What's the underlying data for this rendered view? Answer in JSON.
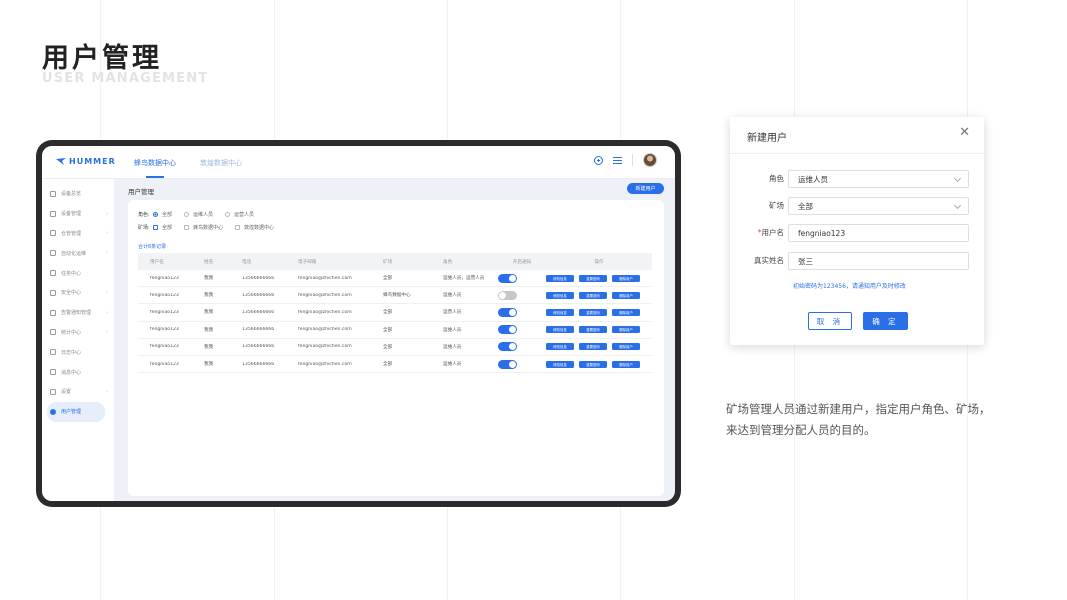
{
  "page": {
    "title": "用户管理",
    "subtitle": "USER MANAGEMENT",
    "description_line1": "矿场管理人员通过新建用户，指定用户角色、矿场，",
    "description_line2": "来达到管理分配人员的目的。"
  },
  "app": {
    "logo": "HUMMER",
    "tabs": [
      {
        "label": "蜂鸟数据中心",
        "active": true
      },
      {
        "label": "敦煌数据中心",
        "active": false
      }
    ],
    "icons": [
      "plus-circle-icon",
      "list-icon",
      "avatar"
    ]
  },
  "sidebar": {
    "items": [
      {
        "label": "设备总览",
        "icon": "dashboard-icon",
        "has_children": false
      },
      {
        "label": "设备管理",
        "icon": "device-icon",
        "has_children": true
      },
      {
        "label": "仓管管理",
        "icon": "warehouse-icon",
        "has_children": true
      },
      {
        "label": "自动化运维",
        "icon": "automation-icon",
        "has_children": true
      },
      {
        "label": "任务中心",
        "icon": "task-icon",
        "has_children": false
      },
      {
        "label": "安全中心",
        "icon": "shield-icon",
        "has_children": true
      },
      {
        "label": "告警通知管理",
        "icon": "alert-icon",
        "has_children": true
      },
      {
        "label": "统计中心",
        "icon": "chart-icon",
        "has_children": true
      },
      {
        "label": "日志中心",
        "icon": "log-icon",
        "has_children": false
      },
      {
        "label": "消息中心",
        "icon": "message-icon",
        "has_children": false
      },
      {
        "label": "设置",
        "icon": "gear-icon",
        "has_children": true
      },
      {
        "label": "用户管理",
        "icon": "user-icon",
        "has_children": false,
        "active": true
      }
    ]
  },
  "content": {
    "title": "用户管理",
    "new_button": "新建用户",
    "filters": {
      "role_label": "角色:",
      "role_options": [
        {
          "label": "全部",
          "selected": true
        },
        {
          "label": "运维人员",
          "selected": false
        },
        {
          "label": "运营人员",
          "selected": false
        }
      ],
      "site_label": "矿场:",
      "site_options": [
        {
          "label": "全部",
          "checked": true
        },
        {
          "label": "蜂鸟数据中心",
          "checked": false
        },
        {
          "label": "敦煌数据中心",
          "checked": false
        }
      ]
    },
    "total_text": "合计6条记录",
    "table": {
      "columns": [
        "用户名",
        "姓名",
        "电话",
        "电子邮箱",
        "矿场",
        "角色",
        "开启通知",
        "操作"
      ],
      "rows": [
        {
          "username": "fengniao123",
          "name": "我我",
          "phone": "13566666666",
          "email": "fengniao@zhichen.com",
          "site": "全部",
          "role": "运维人员，运营人员",
          "notify": true
        },
        {
          "username": "fengniao123",
          "name": "我我",
          "phone": "13566666666",
          "email": "fengniao@zhichen.com",
          "site": "蜂鸟数据中心",
          "role": "运维人员",
          "notify": false
        },
        {
          "username": "fengniao123",
          "name": "我我",
          "phone": "13566666666",
          "email": "fengniao@zhichen.com",
          "site": "全部",
          "role": "运营人员",
          "notify": true
        },
        {
          "username": "fengniao123",
          "name": "我我",
          "phone": "13566666666",
          "email": "fengniao@zhichen.com",
          "site": "全部",
          "role": "运维人员",
          "notify": true
        },
        {
          "username": "fengniao123",
          "name": "我我",
          "phone": "13566666666",
          "email": "fengniao@zhichen.com",
          "site": "全部",
          "role": "运维人员",
          "notify": true
        },
        {
          "username": "fengniao123",
          "name": "我我",
          "phone": "13566666666",
          "email": "fengniao@zhichen.com",
          "site": "全部",
          "role": "运维人员",
          "notify": true
        }
      ],
      "actions": [
        "修改信息",
        "重置密码",
        "删除用户"
      ]
    }
  },
  "dialog": {
    "title": "新建用户",
    "fields": [
      {
        "label": "角色",
        "value": "运维人员",
        "type": "select",
        "required": false
      },
      {
        "label": "矿场",
        "value": "全部",
        "type": "select",
        "required": false
      },
      {
        "label": "用户名",
        "value": "fengniao123",
        "type": "input",
        "required": true
      },
      {
        "label": "真实姓名",
        "value": "张三",
        "type": "input",
        "required": false
      }
    ],
    "hint": "初始密码为123456，请通知用户及时修改",
    "cancel": "取 消",
    "confirm": "确 定"
  },
  "colors": {
    "accent": "#2a6fe8",
    "frame": "#2b2b2b",
    "background": "#ffffff"
  }
}
